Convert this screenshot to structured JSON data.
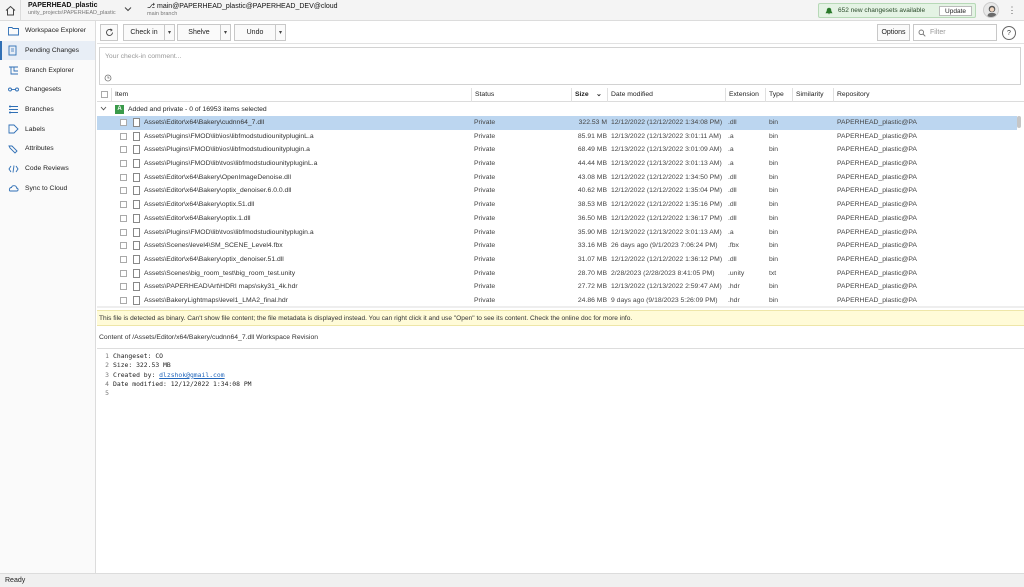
{
  "topbar": {
    "workspace_name": "PAPERHEAD_plastic",
    "workspace_path": "unity_projects\\PAPERHEAD_plastic",
    "branch_name": "main@PAPERHEAD_plastic@PAPERHEAD_DEV@cloud",
    "branch_sub": "main branch",
    "notification": "652 new changesets available",
    "update_label": "Update"
  },
  "sidebar": {
    "items": [
      {
        "label": "Workspace Explorer",
        "icon": "folder-icon"
      },
      {
        "label": "Pending Changes",
        "icon": "pending-changes-icon"
      },
      {
        "label": "Branch Explorer",
        "icon": "branch-explorer-icon"
      },
      {
        "label": "Changesets",
        "icon": "changesets-icon"
      },
      {
        "label": "Branches",
        "icon": "branches-icon"
      },
      {
        "label": "Labels",
        "icon": "label-icon"
      },
      {
        "label": "Attributes",
        "icon": "attributes-icon"
      },
      {
        "label": "Code Reviews",
        "icon": "code-reviews-icon"
      },
      {
        "label": "Sync to Cloud",
        "icon": "cloud-sync-icon"
      }
    ],
    "active_index": 1
  },
  "toolbar": {
    "checkin_label": "Check in",
    "shelve_label": "Shelve",
    "undo_label": "Undo",
    "options_label": "Options",
    "filter_placeholder": "Filter"
  },
  "comment": {
    "placeholder": "Your check-in comment..."
  },
  "grid": {
    "columns": [
      "Item",
      "Status",
      "Size",
      "Date modified",
      "Extension",
      "Type",
      "Similarity",
      "Repository"
    ],
    "group_badge": "A",
    "group_label": "Added and private - 0 of 16953 items selected",
    "rows": [
      {
        "item": "Assets\\Editor\\x64\\Bakery\\cudnn64_7.dll",
        "status": "Private",
        "size": "322.53 M",
        "date": "12/12/2022 (12/12/2022 1:34:08 PM)",
        "ext": ".dll",
        "type": "bin",
        "repo": "PAPERHEAD_plastic@PAP",
        "selected": true
      },
      {
        "item": "Assets\\Plugins\\FMOD\\lib\\ios\\libfmodstudiounitypluginL.a",
        "status": "Private",
        "size": "85.91 MB",
        "date": "12/13/2022 (12/13/2022 3:01:11 AM)",
        "ext": ".a",
        "type": "bin",
        "repo": "PAPERHEAD_plastic@PAP"
      },
      {
        "item": "Assets\\Plugins\\FMOD\\lib\\ios\\libfmodstudiounityplugin.a",
        "status": "Private",
        "size": "68.49 MB",
        "date": "12/13/2022 (12/13/2022 3:01:09 AM)",
        "ext": ".a",
        "type": "bin",
        "repo": "PAPERHEAD_plastic@PAP"
      },
      {
        "item": "Assets\\Plugins\\FMOD\\lib\\tvos\\libfmodstudiounitypluginL.a",
        "status": "Private",
        "size": "44.44 MB",
        "date": "12/13/2022 (12/13/2022 3:01:13 AM)",
        "ext": ".a",
        "type": "bin",
        "repo": "PAPERHEAD_plastic@PAP"
      },
      {
        "item": "Assets\\Editor\\x64\\Bakery\\OpenImageDenoise.dll",
        "status": "Private",
        "size": "43.08 MB",
        "date": "12/12/2022 (12/12/2022 1:34:50 PM)",
        "ext": ".dll",
        "type": "bin",
        "repo": "PAPERHEAD_plastic@PAP"
      },
      {
        "item": "Assets\\Editor\\x64\\Bakery\\optix_denoiser.6.0.0.dll",
        "status": "Private",
        "size": "40.62 MB",
        "date": "12/12/2022 (12/12/2022 1:35:04 PM)",
        "ext": ".dll",
        "type": "bin",
        "repo": "PAPERHEAD_plastic@PAP"
      },
      {
        "item": "Assets\\Editor\\x64\\Bakery\\optix.51.dll",
        "status": "Private",
        "size": "38.53 MB",
        "date": "12/12/2022 (12/12/2022 1:35:16 PM)",
        "ext": ".dll",
        "type": "bin",
        "repo": "PAPERHEAD_plastic@PAP"
      },
      {
        "item": "Assets\\Editor\\x64\\Bakery\\optix.1.dll",
        "status": "Private",
        "size": "36.50 MB",
        "date": "12/12/2022 (12/12/2022 1:36:17 PM)",
        "ext": ".dll",
        "type": "bin",
        "repo": "PAPERHEAD_plastic@PAP"
      },
      {
        "item": "Assets\\Plugins\\FMOD\\lib\\tvos\\libfmodstudiounityplugin.a",
        "status": "Private",
        "size": "35.90 MB",
        "date": "12/13/2022 (12/13/2022 3:01:13 AM)",
        "ext": ".a",
        "type": "bin",
        "repo": "PAPERHEAD_plastic@PAP"
      },
      {
        "item": "Assets\\Scenes\\level4\\SM_SCENE_Level4.fbx",
        "status": "Private",
        "size": "33.16 MB",
        "date": "26 days ago (9/1/2023 7:06:24 PM)",
        "ext": ".fbx",
        "type": "bin",
        "repo": "PAPERHEAD_plastic@PAP"
      },
      {
        "item": "Assets\\Editor\\x64\\Bakery\\optix_denoiser.51.dll",
        "status": "Private",
        "size": "31.07 MB",
        "date": "12/12/2022 (12/12/2022 1:36:12 PM)",
        "ext": ".dll",
        "type": "bin",
        "repo": "PAPERHEAD_plastic@PAP"
      },
      {
        "item": "Assets\\Scenes\\big_room_test\\big_room_test.unity",
        "status": "Private",
        "size": "28.70 MB",
        "date": "2/28/2023 (2/28/2023 8:41:05 PM)",
        "ext": ".unity",
        "type": "txt",
        "repo": "PAPERHEAD_plastic@PAP"
      },
      {
        "item": "Assets\\PAPERHEAD\\Art\\HDRI maps\\sky31_4k.hdr",
        "status": "Private",
        "size": "27.72 MB",
        "date": "12/13/2022 (12/13/2022 2:59:47 AM)",
        "ext": ".hdr",
        "type": "bin",
        "repo": "PAPERHEAD_plastic@PAP"
      },
      {
        "item": "Assets\\BakeryLightmaps\\level1_LMA2_final.hdr",
        "status": "Private",
        "size": "24.86 MB",
        "date": "9 days ago (9/18/2023 5:26:09 PM)",
        "ext": ".hdr",
        "type": "bin",
        "repo": "PAPERHEAD_plastic@PAP"
      }
    ]
  },
  "banner": "This file is detected as binary. Can't show file content; the file metadata is displayed instead. You can right click it and use \"Open\" to see its content. Check the online doc for more info.",
  "content_title": "Content of /Assets/Editor/x64/Bakery/cudnn64_7.dll Workspace Revision",
  "code": {
    "line1": "Changeset: CO",
    "line2": "Size: 322.53 MB",
    "line3_prefix": "Created by: ",
    "line3_link": "dlzshok@gmail.com",
    "line4": "Date modified: 12/12/2022 1:34:08 PM",
    "line5": ""
  },
  "statusbar": "Ready",
  "colors": {
    "accent": "#2f6fb5",
    "selected_row": "#bcd6f0",
    "banner": "#fffbd8",
    "notify": "#e4f3e4"
  }
}
